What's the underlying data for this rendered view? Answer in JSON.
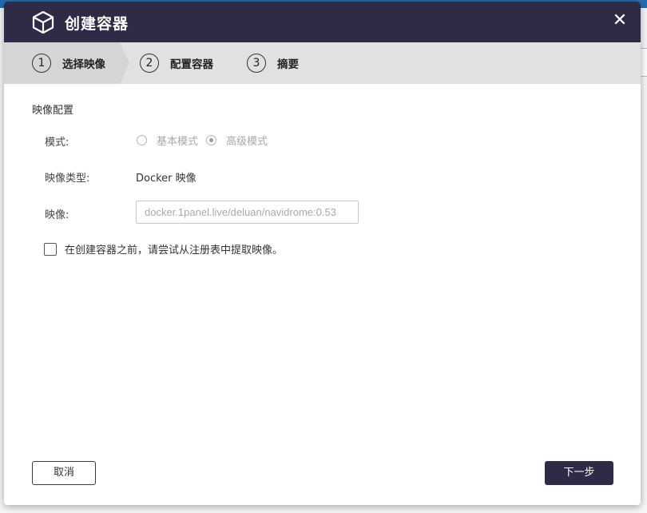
{
  "dialog": {
    "title": "创建容器",
    "title_icon": "cube-icon",
    "close_glyph": "✕"
  },
  "steps": [
    {
      "num": "1",
      "label": "选择映像",
      "active": true
    },
    {
      "num": "2",
      "label": "配置容器",
      "active": false
    },
    {
      "num": "3",
      "label": "摘要",
      "active": false
    }
  ],
  "form": {
    "section_title": "映像配置",
    "mode_label": "模式:",
    "mode_options": [
      {
        "label": "基本模式",
        "checked": false
      },
      {
        "label": "高级模式",
        "checked": true
      }
    ],
    "image_type_label": "映像类型:",
    "image_type_value": "Docker 映像",
    "image_label": "映像:",
    "image_value": "docker.1panel.live/deluan/navidrome:0.53",
    "pull_checkbox_label": "在创建容器之前，请尝试从注册表中提取映像。",
    "pull_checked": false
  },
  "buttons": {
    "cancel": "取消",
    "next": "下一步"
  },
  "colors": {
    "titlebar": "#2f2b47",
    "stepbar": "#e1e1e1",
    "active_step": "#d5d5d5",
    "primary_button": "#2f2b47"
  }
}
